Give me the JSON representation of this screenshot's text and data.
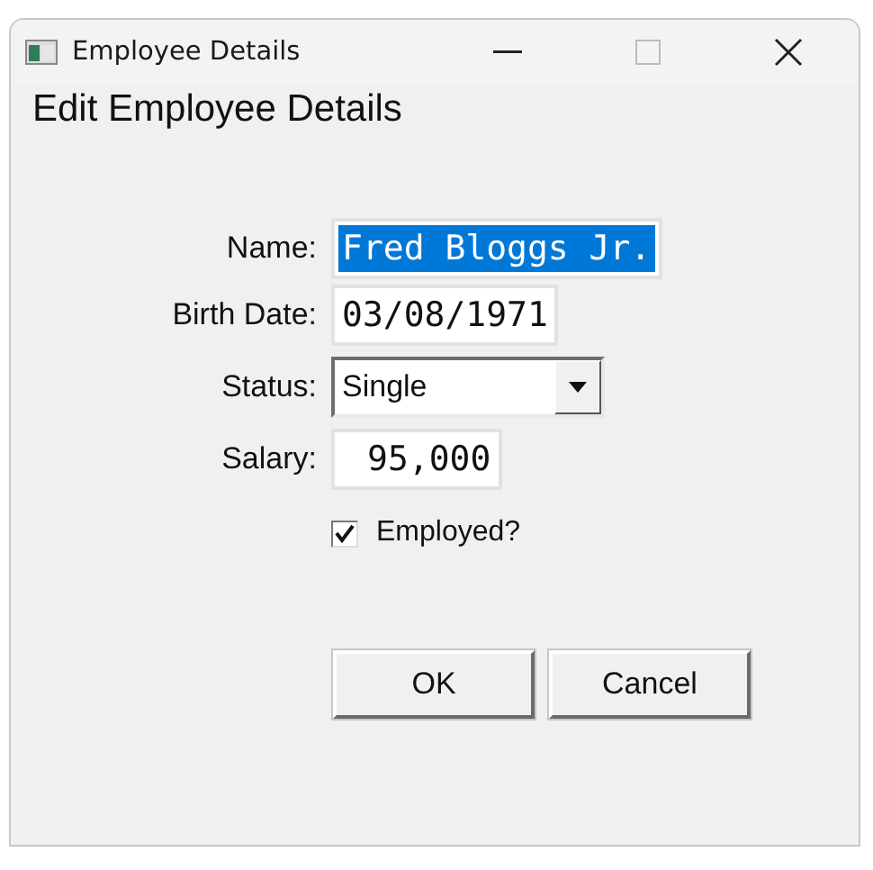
{
  "window": {
    "title": "Employee Details"
  },
  "heading": "Edit Employee Details",
  "fields": [
    {
      "kind": "text",
      "label": "Name:",
      "value": "Fred Bloggs Jr.",
      "text_selected": true
    },
    {
      "kind": "text",
      "label": "Birth Date:",
      "value": "03/08/1971",
      "text_selected": false
    },
    {
      "kind": "select",
      "label": "Status:",
      "value": "Single"
    },
    {
      "kind": "number",
      "label": "Salary:",
      "value": "95,000",
      "text_selected": false
    }
  ],
  "employed": {
    "label": "Employed?",
    "checked": true
  },
  "buttons": [
    "OK",
    "Cancel"
  ]
}
